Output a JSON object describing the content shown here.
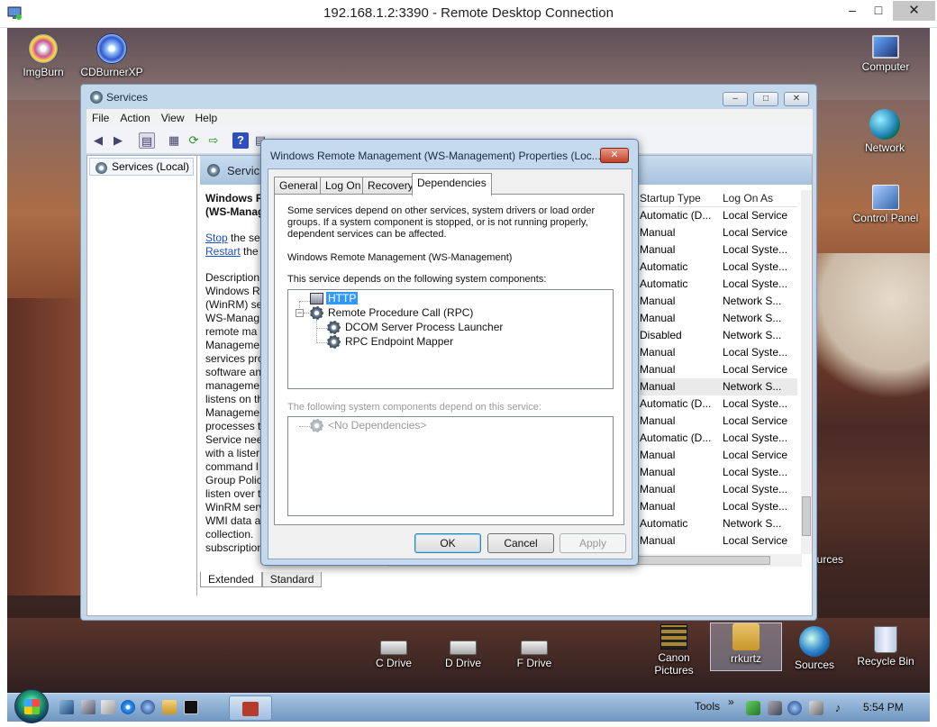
{
  "rdp": {
    "title": "192.168.1.2:3390 - Remote Desktop Connection",
    "min": "–",
    "max": "□",
    "close": "✕"
  },
  "desktop_icons": [
    {
      "label": "ImgBurn",
      "icon": "disc-icon"
    },
    {
      "label": "CDBurnerXP",
      "icon": "cd-icon"
    },
    {
      "label": "Computer",
      "icon": "computer-icon"
    },
    {
      "label": "Network",
      "icon": "network-icon"
    },
    {
      "label": "Control Panel",
      "icon": "control-panel-icon"
    },
    {
      "label": "ources",
      "icon": "sources-icon"
    },
    {
      "label": "C Drive",
      "icon": "drive-icon"
    },
    {
      "label": "D Drive",
      "icon": "drive-icon"
    },
    {
      "label": "F Drive",
      "icon": "drive-icon"
    },
    {
      "label": "Canon Pictures",
      "icon": "film-icon"
    },
    {
      "label": "rrkurtz",
      "icon": "user-folder-icon"
    },
    {
      "label": "Sources",
      "icon": "sources-icon"
    },
    {
      "label": "Recycle Bin",
      "icon": "recycle-bin-icon"
    }
  ],
  "services": {
    "title": "Services",
    "menu": [
      "File",
      "Action",
      "View",
      "Help"
    ],
    "tree_node": "Services (Local)",
    "header_title": "Servic",
    "desc": {
      "name_line1": "Windows R",
      "name_line2": "(WS-Manag",
      "stop_link": "Stop",
      "stop_rest": " the ser",
      "restart_link": "Restart",
      "restart_rest": " the",
      "lines": [
        "Description",
        "Windows R",
        "(WinRM) se",
        "WS-Manag",
        "remote ma",
        "Manageme",
        "services pro",
        "software an",
        "manageme",
        "listens on th",
        "Manageme",
        "processes th",
        "Service nee",
        "with a lister",
        "command l",
        "Group Polic",
        "listen over t",
        "WinRM serv",
        "WMI data a",
        "collection.",
        "subscription to events require that"
      ]
    },
    "columns": {
      "startup": "Startup Type",
      "logon": "Log On As"
    },
    "rows": [
      {
        "startup": "Automatic (D...",
        "logon": "Local Service"
      },
      {
        "startup": "Manual",
        "logon": "Local Service"
      },
      {
        "startup": "Manual",
        "logon": "Local Syste..."
      },
      {
        "startup": "Automatic",
        "logon": "Local Syste..."
      },
      {
        "startup": "Automatic",
        "logon": "Local Syste..."
      },
      {
        "startup": "Manual",
        "logon": "Network S..."
      },
      {
        "startup": "Manual",
        "logon": "Network S..."
      },
      {
        "startup": "Disabled",
        "logon": "Network S..."
      },
      {
        "startup": "Manual",
        "logon": "Local Syste..."
      },
      {
        "startup": "Manual",
        "logon": "Local Service"
      },
      {
        "startup": "Manual",
        "logon": "Network S...",
        "highlight": true
      },
      {
        "startup": "Automatic (D...",
        "logon": "Local Syste..."
      },
      {
        "startup": "Manual",
        "logon": "Local Service"
      },
      {
        "startup": "Automatic (D...",
        "logon": "Local Syste..."
      },
      {
        "startup": "Manual",
        "logon": "Local Service"
      },
      {
        "startup": "Manual",
        "logon": "Local Syste..."
      },
      {
        "startup": "Manual",
        "logon": "Local Syste..."
      },
      {
        "startup": "Manual",
        "logon": "Local Syste..."
      },
      {
        "startup": "Automatic",
        "logon": "Network S..."
      },
      {
        "startup": "Manual",
        "logon": "Local Service"
      }
    ],
    "view_tabs": [
      "Extended",
      "Standard"
    ]
  },
  "dialog": {
    "title": "Windows Remote Management (WS-Management) Properties (Loc...",
    "close": "✕",
    "tabs": [
      "General",
      "Log On",
      "Recovery",
      "Dependencies"
    ],
    "active_tab": "Dependencies",
    "intro": "Some services depend on other services, system drivers or load order groups. If a system component is stopped, or is not running properly, dependent services can be affected.",
    "service_name": "Windows Remote Management (WS-Management)",
    "depends_label": "This service depends on the following system components:",
    "depends": {
      "http": "HTTP",
      "rpc": "Remote Procedure Call (RPC)",
      "dcom": "DCOM Server Process Launcher",
      "mapper": "RPC Endpoint Mapper"
    },
    "dependents_label": "The following system components depend on this service:",
    "no_deps": "<No Dependencies>",
    "ok": "OK",
    "cancel": "Cancel",
    "apply": "Apply"
  },
  "taskbar": {
    "tools": "Tools",
    "chevron": "»",
    "clock": "5:54 PM"
  }
}
